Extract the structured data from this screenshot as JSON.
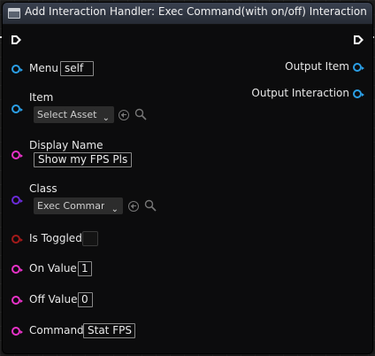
{
  "node": {
    "title": "Add Interaction Handler: Exec Command(with on/off) Interaction"
  },
  "outputs": [
    {
      "label": "Output Item"
    },
    {
      "label": "Output Interaction"
    }
  ],
  "inputs": {
    "menu": {
      "label": "Menu",
      "value": "self"
    },
    "item": {
      "label": "Item",
      "dropdown": "Select Asset"
    },
    "display_name": {
      "label": "Display Name",
      "value": "Show my FPS Pls"
    },
    "class": {
      "label": "Class",
      "dropdown": "Exec Command"
    },
    "is_toggled": {
      "label": "Is Toggled",
      "checked": false
    },
    "on_value": {
      "label": "On Value",
      "value": "1"
    },
    "off_value": {
      "label": "Off Value",
      "value": "0"
    },
    "command": {
      "label": "Command",
      "value": "Stat FPS"
    }
  },
  "icons": {
    "function": "function-icon",
    "exec": "exec-pin-icon",
    "use_asset": "use-selected-asset-icon",
    "browse": "search-icon"
  },
  "colors": {
    "object_pin": "#2b9fe6",
    "string_pin": "#e832c8",
    "class_pin": "#6a2bd9",
    "bool_pin": "#a41a1a"
  }
}
